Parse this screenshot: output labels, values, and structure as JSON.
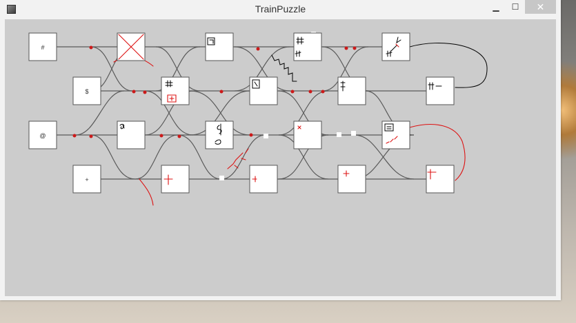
{
  "window": {
    "title": "TrainPuzzle",
    "minimize_glyph": "▁",
    "maximize_glyph": "☐",
    "close_glyph": "✕"
  },
  "stations": {
    "row1_col0": "#",
    "row2_col0": "$",
    "row3_col0": "@",
    "row4_col0": "+"
  },
  "colors": {
    "canvas": "#cccccc",
    "track": "#5a5a5a",
    "ink_red": "#d11111"
  }
}
